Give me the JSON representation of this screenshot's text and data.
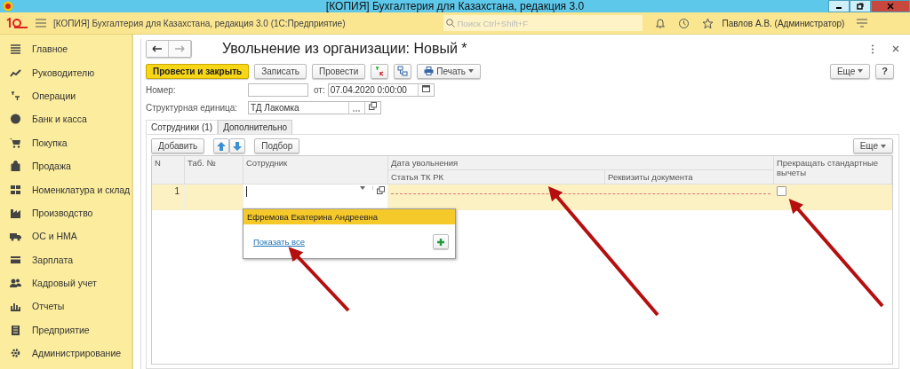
{
  "window": {
    "title": "[КОПИЯ] Бухгалтерия для Казахстана, редакция 3.0"
  },
  "app_bar": {
    "title": "[КОПИЯ] Бухгалтерия для Казахстана, редакция 3.0  (1С:Предприятие)",
    "search": {
      "placeholder": "Поиск Ctrl+Shift+F"
    },
    "user": "Павлов А.В. (Администратор)"
  },
  "sidebar": {
    "items": [
      {
        "label": "Главное"
      },
      {
        "label": "Руководителю"
      },
      {
        "label": "Операции"
      },
      {
        "label": "Банк и касса"
      },
      {
        "label": "Покупка"
      },
      {
        "label": "Продажа"
      },
      {
        "label": "Номенклатура и склад"
      },
      {
        "label": "Производство"
      },
      {
        "label": "ОС и НМА"
      },
      {
        "label": "Зарплата"
      },
      {
        "label": "Кадровый учет"
      },
      {
        "label": "Отчеты"
      },
      {
        "label": "Предприятие"
      },
      {
        "label": "Администрирование"
      }
    ]
  },
  "form": {
    "title": "Увольнение из организации: Новый *",
    "toolbar": [
      {
        "kind": "primary",
        "label": "Провести и закрыть"
      },
      {
        "kind": "plain",
        "label": "Записать"
      },
      {
        "kind": "plain",
        "label": "Провести"
      },
      {
        "kind": "dtkt"
      },
      {
        "kind": "structure"
      },
      {
        "kind": "print",
        "label": "Печать"
      }
    ],
    "more": "Еще",
    "help": "?",
    "number": {
      "label": "Номер:"
    },
    "date": {
      "label": "от:",
      "value": "07.04.2020  0:00:00"
    },
    "unit": {
      "label": "Структурная единица:",
      "value": "ТД Лакомка"
    },
    "tabs": [
      {
        "label": "Сотрудники (1)",
        "selected": true
      },
      {
        "label": "Дополнительно",
        "selected": false
      }
    ],
    "table_toolbar": {
      "add": "Добавить",
      "pick": "Подбор",
      "more": "Еще"
    },
    "table": {
      "columns": {
        "n": "N",
        "tab": "Таб. №",
        "employee": "Сотрудник",
        "date": "Дата увольнения",
        "article": "Статья ТК РК",
        "details": "Реквизиты документа",
        "stop": "Прекращать стандартные вычеты"
      },
      "rows": [
        {
          "n": "1",
          "selected": true,
          "stop_checked": false
        }
      ]
    },
    "dropdown": {
      "items": [
        {
          "label": "Ефремова Екатерина Андреевна",
          "selected": true
        }
      ],
      "show_all": "Показать все"
    }
  }
}
